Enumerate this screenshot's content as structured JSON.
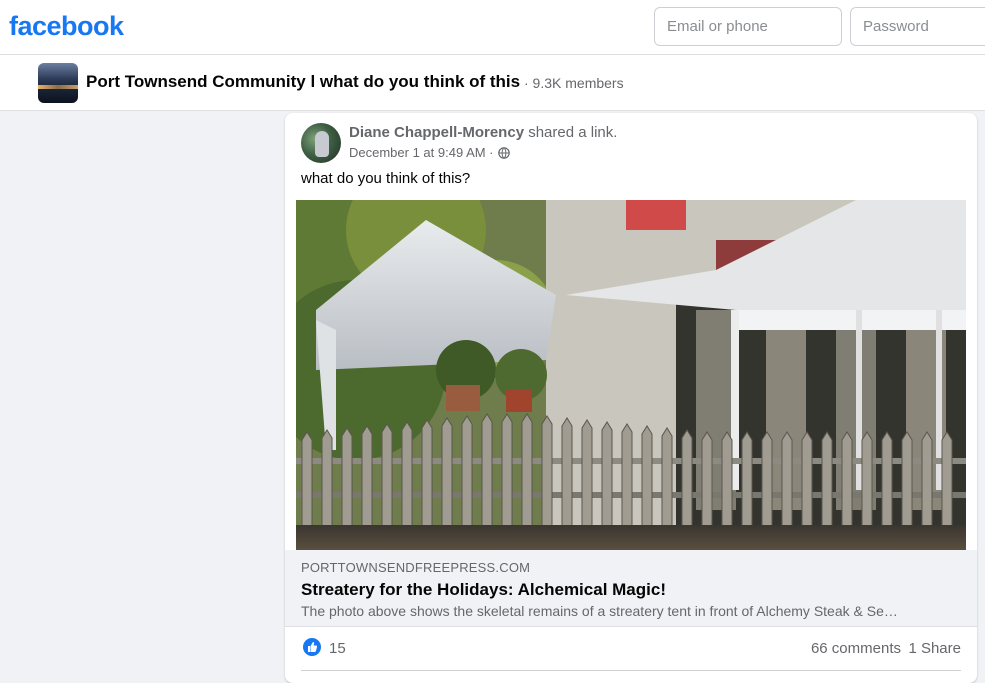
{
  "header": {
    "logo_text": "facebook",
    "email_placeholder": "Email or phone",
    "password_placeholder": "Password",
    "brand_color": "#1877f2"
  },
  "group": {
    "name": "Port Townsend Community l what do you think of this",
    "members": "· 9.3K members"
  },
  "post": {
    "author": "Diane Chappell-Morency",
    "action": "shared a link.",
    "timestamp": "December 1 at 9:49 AM ·",
    "privacy_icon": "globe-icon",
    "text": "what do you think of this?",
    "link": {
      "domain": "PORTTOWNSENDFREEPRESS.COM",
      "title": "Streatery for the Holidays: Alchemical Magic!",
      "description": "The photo above shows the skeletal remains of a streatery tent in front of Alchemy Steak & Se…"
    },
    "reactions": {
      "icon": "like-icon",
      "count": "15",
      "comments": "66 comments",
      "shares": "1 Share"
    }
  }
}
